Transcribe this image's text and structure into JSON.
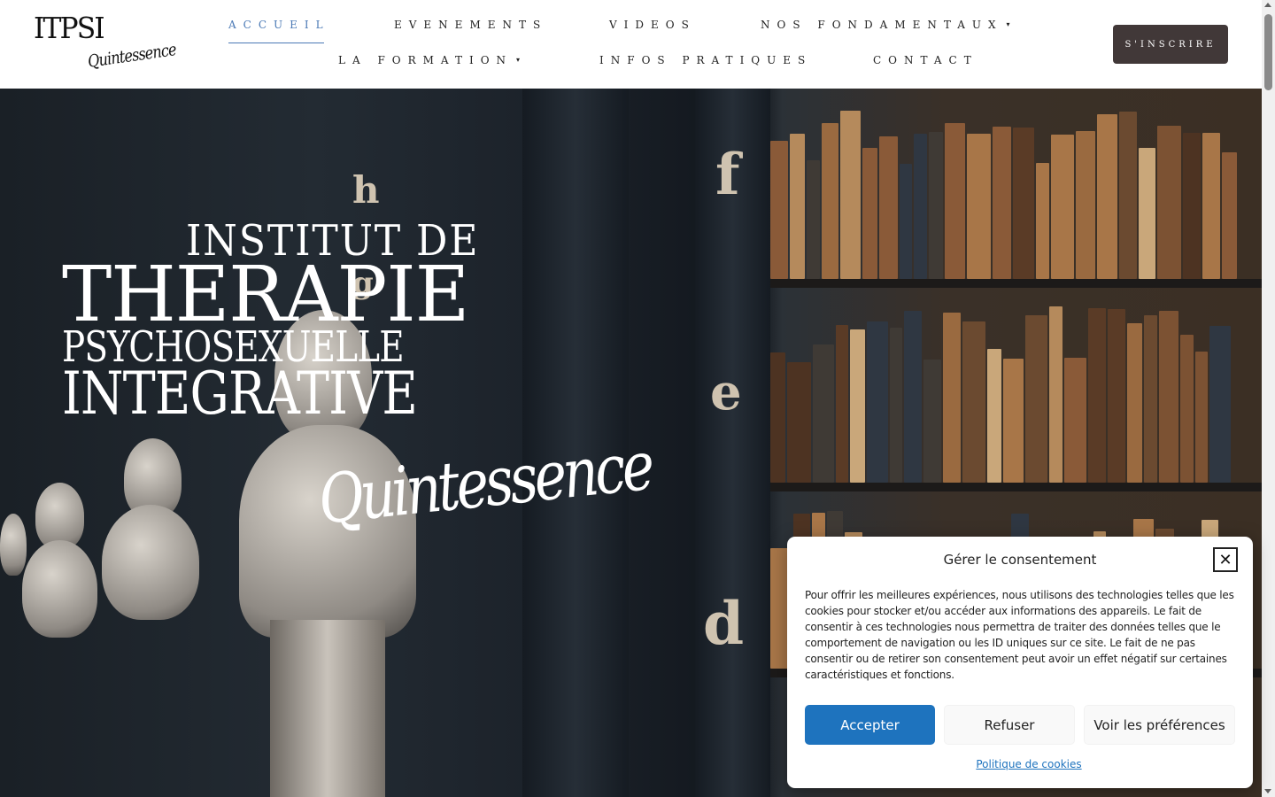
{
  "logo": {
    "main": "ITPSI",
    "script": "Quintessence"
  },
  "nav": {
    "row1": [
      {
        "label": "ACCUEIL",
        "active": true
      },
      {
        "label": "EVENEMENTS"
      },
      {
        "label": "VIDEOS"
      },
      {
        "label": "NOS FONDAMENTAUX",
        "caret": true
      }
    ],
    "row2": [
      {
        "label": "LA FORMATION",
        "caret": true
      },
      {
        "label": "INFOS PRATIQUES"
      },
      {
        "label": "CONTACT"
      }
    ],
    "caret_glyph": "▾",
    "active_color": "#4a79b5"
  },
  "signup": {
    "label": "S'INSCRIRE"
  },
  "hero": {
    "line1": "INSTITUT DE",
    "line2": "THERAPIE",
    "line3": "PSYCHOSEXUELLE",
    "line4": "INTEGRATIVE",
    "script": "Quintessence",
    "shelf_letters": [
      "h",
      "g",
      "f",
      "e",
      "d"
    ]
  },
  "cookie": {
    "title": "Gérer le consentement",
    "close_glyph": "✕",
    "text": "Pour offrir les meilleures expériences, nous utilisons des technologies telles que les cookies pour stocker et/ou accéder aux informations des appareils. Le fait de consentir à ces technologies nous permettra de traiter des données telles que le comportement de navigation ou les ID uniques sur ce site. Le fait de ne pas consentir ou de retirer son consentement peut avoir un effet négatif sur certaines caractéristiques et fonctions.",
    "accept": "Accepter",
    "refuse": "Refuser",
    "prefs": "Voir les préférences",
    "policy": "Politique de cookies",
    "accent": "#1e73be"
  }
}
